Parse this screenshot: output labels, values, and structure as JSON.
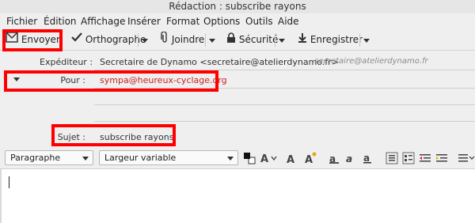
{
  "window": {
    "title": "Rédaction : subscribe rayons"
  },
  "menu": [
    "Fichier",
    "Édition",
    "Affichage",
    "Insérer",
    "Format",
    "Options",
    "Outils",
    "Aide"
  ],
  "toolbar": {
    "send_label": "Envoyer",
    "spelling_label": "Orthographe",
    "attach_label": "Joindre",
    "security_label": "Sécurité",
    "save_label": "Enregistrer"
  },
  "headers": {
    "from_label": "Expéditeur :",
    "from_value": "Secretaire de Dynamo <secretaire@atelierdynamo.fr>",
    "from_identity": "secretaire@atelierdynamo.fr",
    "to_label": "Pour :",
    "to_value": "sympa@heureux-cyclage.org",
    "subject_label": "Sujet :",
    "subject_value": "subscribe rayons"
  },
  "format": {
    "paragraph_select": "Paragraphe",
    "font_select": "Largeur variable"
  },
  "colors": {
    "highlight": "#ff0000",
    "recipient": "#cc1f1f",
    "chrome": "#efefef"
  },
  "icons": [
    "send-icon",
    "spellcheck-icon",
    "paperclip-icon",
    "lock-icon",
    "save-icon",
    "text-color-icon",
    "font-size-icon",
    "bold-icon",
    "italic-icon",
    "underline-icon",
    "list-icon"
  ]
}
